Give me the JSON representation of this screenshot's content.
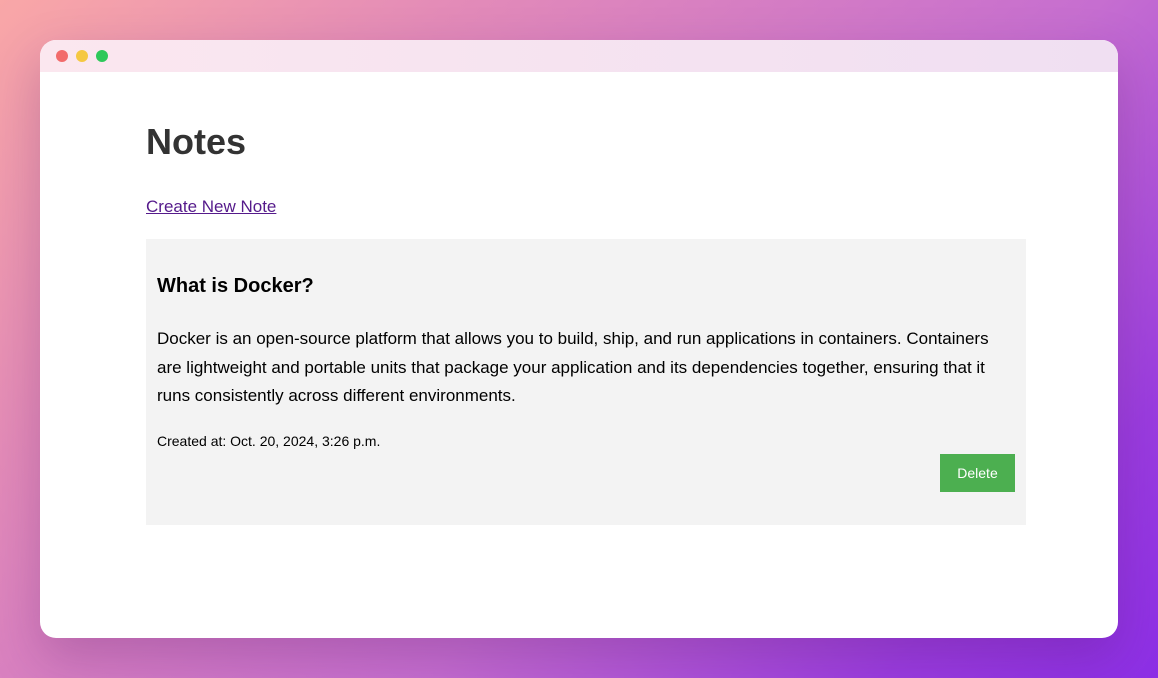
{
  "window": {
    "controls": [
      "close",
      "minimize",
      "maximize"
    ]
  },
  "page": {
    "title": "Notes",
    "create_link": "Create New Note"
  },
  "notes": [
    {
      "title": "What is Docker?",
      "body": "Docker is an open-source platform that allows you to build, ship, and run applications in containers. Containers are lightweight and portable units that package your application and its dependencies together, ensuring that it runs consistently across different environments.",
      "created": "Created at: Oct. 20, 2024, 3:26 p.m.",
      "delete_label": "Delete"
    }
  ],
  "colors": {
    "delete_button": "#4caf50",
    "link": "#551a8b",
    "card_background": "#f3f3f3",
    "heading": "#333333"
  }
}
